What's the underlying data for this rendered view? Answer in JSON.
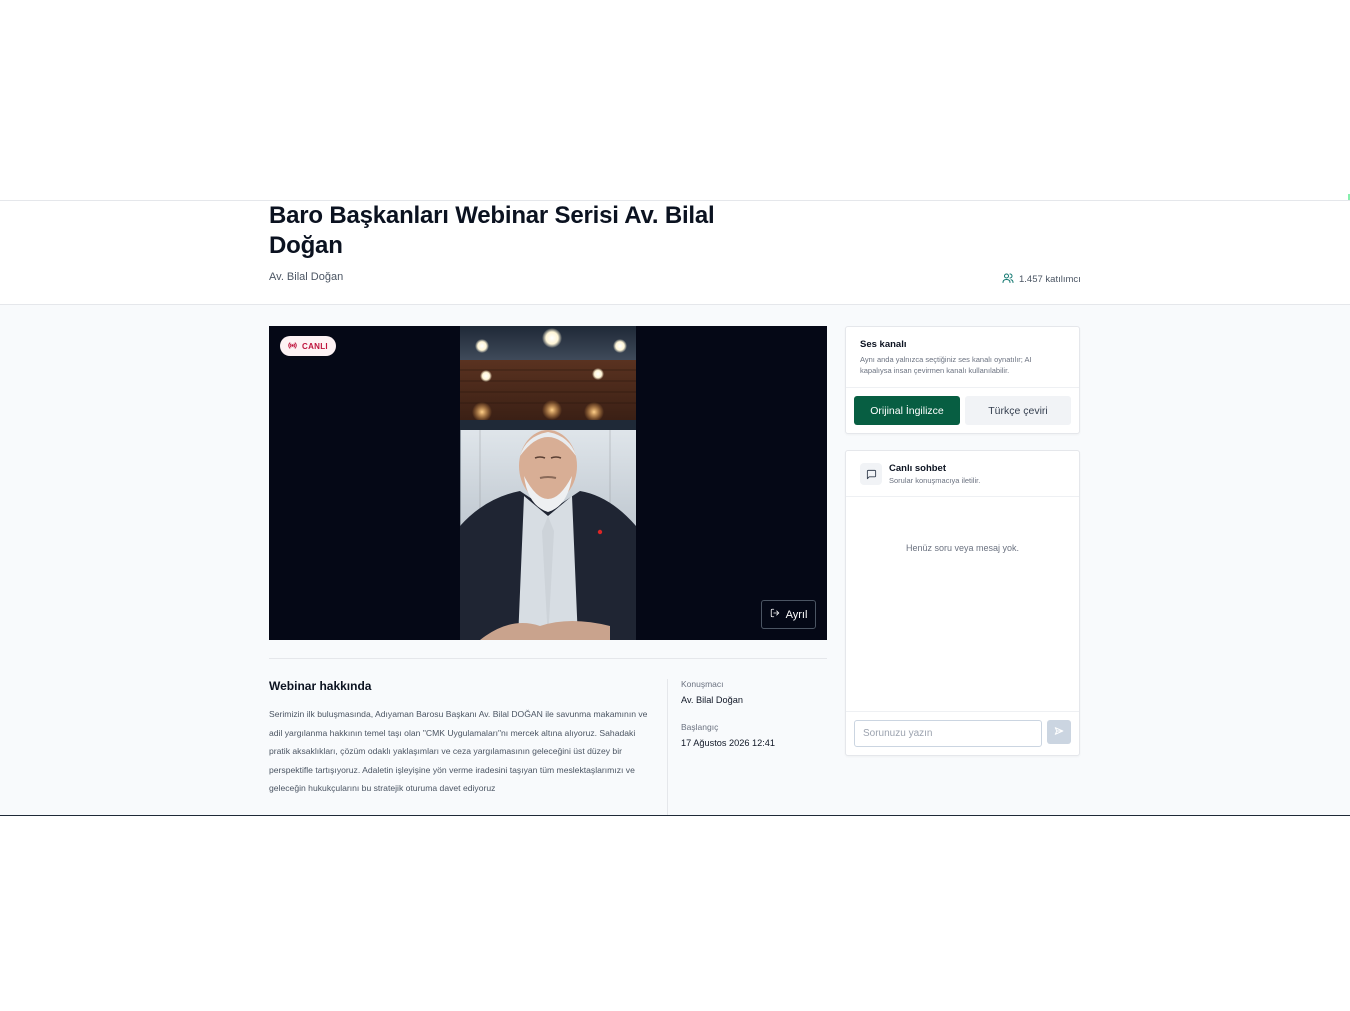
{
  "header": {
    "title": "Baro Başkanları Webinar Serisi Av. Bilal Doğan",
    "speaker": "Av. Bilal Doğan",
    "participants": "1.457 katılımcı",
    "participants_icon": "users-icon"
  },
  "video": {
    "live_badge": "CANLI",
    "live_icon": "broadcast-icon",
    "leave_label": "Ayrıl",
    "leave_icon": "logout-icon"
  },
  "about": {
    "title": "Webinar hakkında",
    "description": "Serimizin ilk buluşmasında, Adıyaman Barosu Başkanı Av. Bilal DOĞAN ile savunma makamının ve adil yargılanma hakkının temel taşı olan \"CMK Uygulamaları\"nı mercek altına alıyoruz. Sahadaki pratik aksaklıkları, çözüm odaklı yaklaşımları ve ceza yargılamasının geleceğini üst düzey bir perspektifle tartışıyoruz. Adaletin işleyişine yön verme iradesini taşıyan tüm meslektaşlarımızı ve geleceğin hukukçularını bu stratejik oturuma davet ediyoruz",
    "speaker_label": "Konuşmacı",
    "speaker_value": "Av. Bilal Doğan",
    "start_label": "Başlangıç",
    "start_value": "17 Ağustos 2026 12:41"
  },
  "audio": {
    "title": "Ses kanalı",
    "description": "Aynı anda yalnızca seçtiğiniz ses kanalı oynatılır; AI kapalıysa insan çevirmen kanalı kullanılabilir.",
    "option_original": "Orijinal İngilizce",
    "option_translation": "Türkçe çeviri"
  },
  "chat": {
    "title": "Canlı sohbet",
    "subtitle": "Sorular konuşmacıya iletilir.",
    "icon": "message-square-icon",
    "empty": "Henüz soru veya mesaj yok.",
    "input_placeholder": "Sorunuzu yazın",
    "send_icon": "send-icon"
  },
  "colors": {
    "primary": "#075e42",
    "live": "#be123c",
    "video_bg": "#050816"
  }
}
